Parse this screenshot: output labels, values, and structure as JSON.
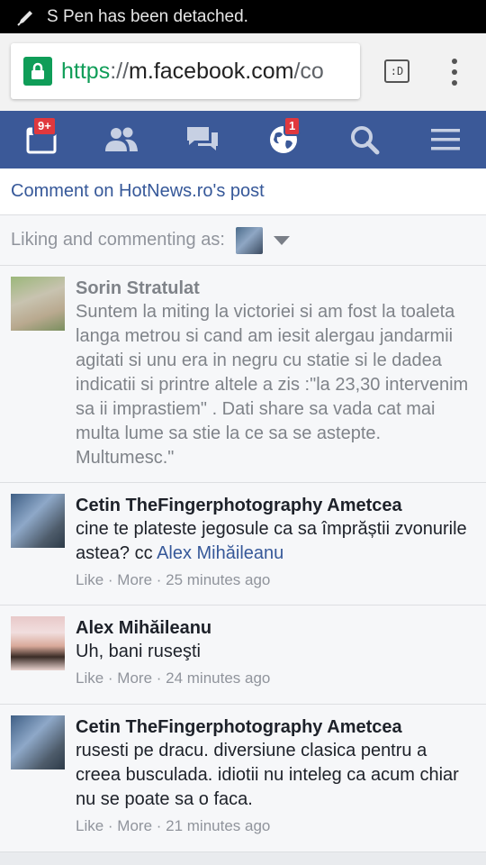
{
  "statusbar": {
    "text": "S Pen has been detached."
  },
  "browser": {
    "url_scheme": "https",
    "url_sep": "://",
    "url_host": "m.facebook.com",
    "url_path": "/co",
    "tabs_label": ":D"
  },
  "nav": {
    "feed_badge": "9+",
    "notif_badge": "1"
  },
  "header": {
    "comment_on": "Comment on HotNews.ro's post",
    "liking_as": "Liking and commenting as:"
  },
  "comments": [
    {
      "author": "Sorin Stratulat",
      "text": "Suntem la miting la victoriei si am fost la toaleta langa metrou si cand am iesit alergau jandarmii agitati si unu era in negru cu statie si le dadea indicatii si printre altele a zis :\"la 23,30 intervenim sa ii imprastiem\" . Dati share sa vada cat mai multa lume sa stie la ce sa se astepte. Multumesc.\""
    },
    {
      "author": "Cetin TheFingerphotography Ametcea",
      "text": "cine te plateste jegosule ca sa împrăștii zvonurile astea? cc ",
      "mention": "Alex Mihăileanu",
      "like": "Like",
      "more": "More",
      "time": "25 minutes ago"
    },
    {
      "author": "Alex Mihăileanu",
      "text": "Uh, bani ruseşti",
      "like": "Like",
      "more": "More",
      "time": "24 minutes ago"
    },
    {
      "author": "Cetin TheFingerphotography Ametcea",
      "text": "rusesti pe dracu. diversiune clasica pentru a creea busculada. idiotii nu inteleg ca acum chiar nu se poate sa o faca.",
      "like": "Like",
      "more": "More",
      "time": "21 minutes ago"
    }
  ],
  "meta_sep": " · ",
  "colors": {
    "fb_blue": "#3b5998",
    "link": "#365899",
    "secure_green": "#0f9d58",
    "badge_red": "#e0383e"
  }
}
